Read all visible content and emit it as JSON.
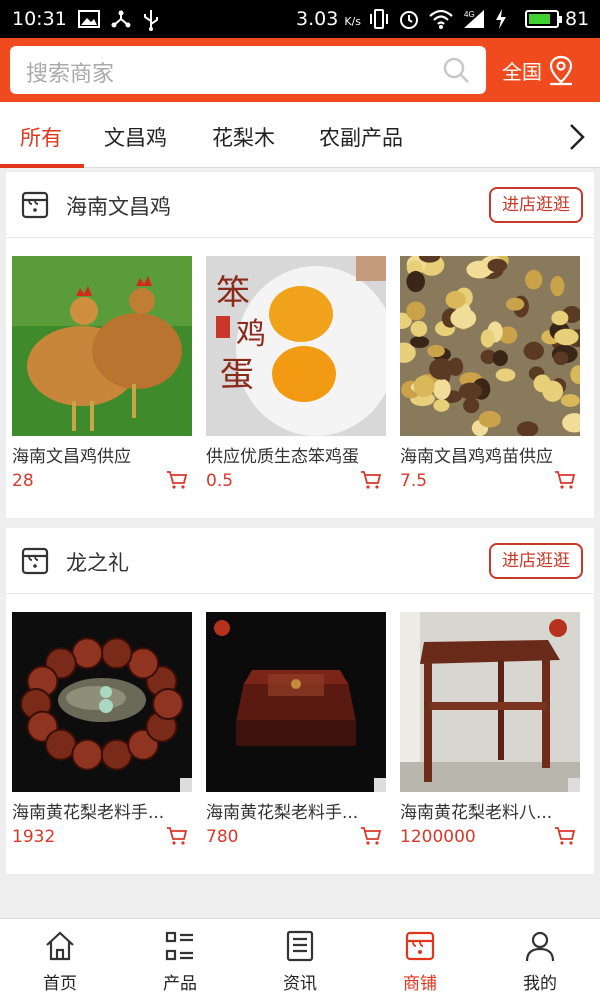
{
  "status_bar": {
    "time": "10:31",
    "speed": "3.03",
    "speed_unit": "K/s",
    "battery": "81",
    "battery_level": 0.81,
    "icons_left": [
      "image-icon",
      "usb-share-icon",
      "usb-icon"
    ],
    "icons_right": [
      "vibrate-icon",
      "alarm-icon",
      "wifi-icon",
      "signal-4g-icon",
      "charging-icon"
    ]
  },
  "header": {
    "search_placeholder": "搜索商家",
    "region_label": "全国",
    "accent_color": "#f04b1e"
  },
  "tabs": [
    {
      "label": "所有",
      "active": true
    },
    {
      "label": "文昌鸡",
      "active": false
    },
    {
      "label": "花梨木",
      "active": false
    },
    {
      "label": "农副产品",
      "active": false
    }
  ],
  "shops": [
    {
      "name": "海南文昌鸡",
      "visit_label": "进店逛逛",
      "products": [
        {
          "name": "海南文昌鸡供应",
          "price": "28",
          "image": "chickens-photo"
        },
        {
          "name": "供应优质生态笨鸡蛋",
          "price": "0.5",
          "image": "eggs-photo",
          "image_text": "笨鸡蛋"
        },
        {
          "name": "海南文昌鸡鸡苗供应",
          "price": "7.5",
          "image": "chicks-photo"
        }
      ]
    },
    {
      "name": "龙之礼",
      "visit_label": "进店逛逛",
      "products": [
        {
          "name": "海南黄花梨老料手...",
          "price": "1932",
          "image": "bead-bracelet-photo"
        },
        {
          "name": "海南黄花梨老料手...",
          "price": "780",
          "image": "wooden-box-photo"
        },
        {
          "name": "海南黄花梨老料八...",
          "price": "1200000",
          "image": "wooden-table-photo"
        }
      ]
    }
  ],
  "bottom_nav": [
    {
      "label": "首页",
      "icon": "home-icon",
      "active": false
    },
    {
      "label": "产品",
      "icon": "list-icon",
      "active": false
    },
    {
      "label": "资讯",
      "icon": "news-icon",
      "active": false
    },
    {
      "label": "商铺",
      "icon": "store-icon",
      "active": true
    },
    {
      "label": "我的",
      "icon": "user-icon",
      "active": false
    }
  ],
  "colors": {
    "price": "#d9372a",
    "active": "#e0361e"
  }
}
